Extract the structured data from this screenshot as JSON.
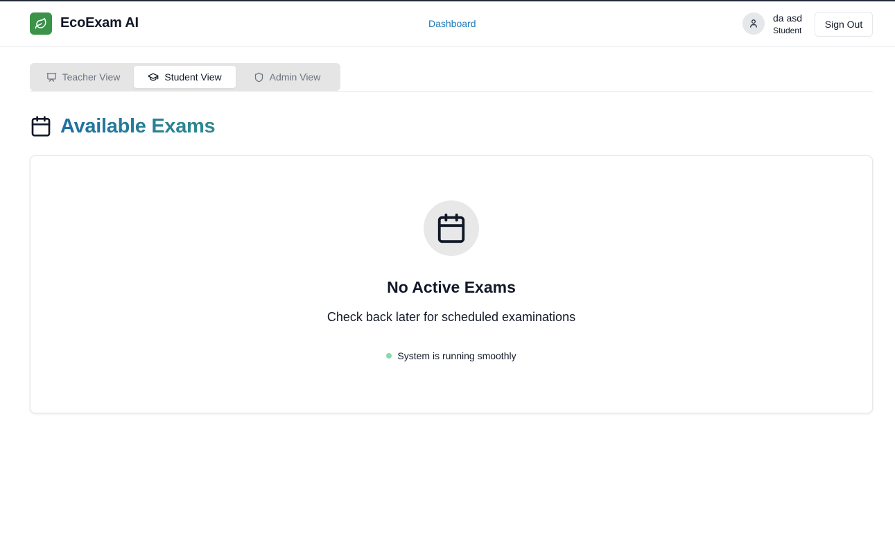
{
  "header": {
    "app_title": "EcoExam AI",
    "logo_icon": "leaf-icon",
    "nav_link": "Dashboard",
    "user": {
      "name": "da asd",
      "role": "Student",
      "avatar_icon": "user-icon"
    },
    "sign_out_label": "Sign Out"
  },
  "tabs": [
    {
      "label": "Teacher View",
      "icon": "presentation-icon",
      "active": false
    },
    {
      "label": "Student View",
      "icon": "graduation-cap-icon",
      "active": true
    },
    {
      "label": "Admin View",
      "icon": "shield-icon",
      "active": false
    }
  ],
  "section": {
    "title": "Available Exams",
    "icon": "calendar-icon"
  },
  "empty_state": {
    "icon": "calendar-icon",
    "title": "No Active Exams",
    "description": "Check back later for scheduled examinations",
    "status_text": "System is running smoothly"
  },
  "colors": {
    "brand_green": "#3a9348",
    "link_blue": "#1e7ab8",
    "title_gradient_start": "#1e6fa3",
    "title_gradient_end": "#2f8a8c",
    "status_dot": "#86dca6"
  }
}
